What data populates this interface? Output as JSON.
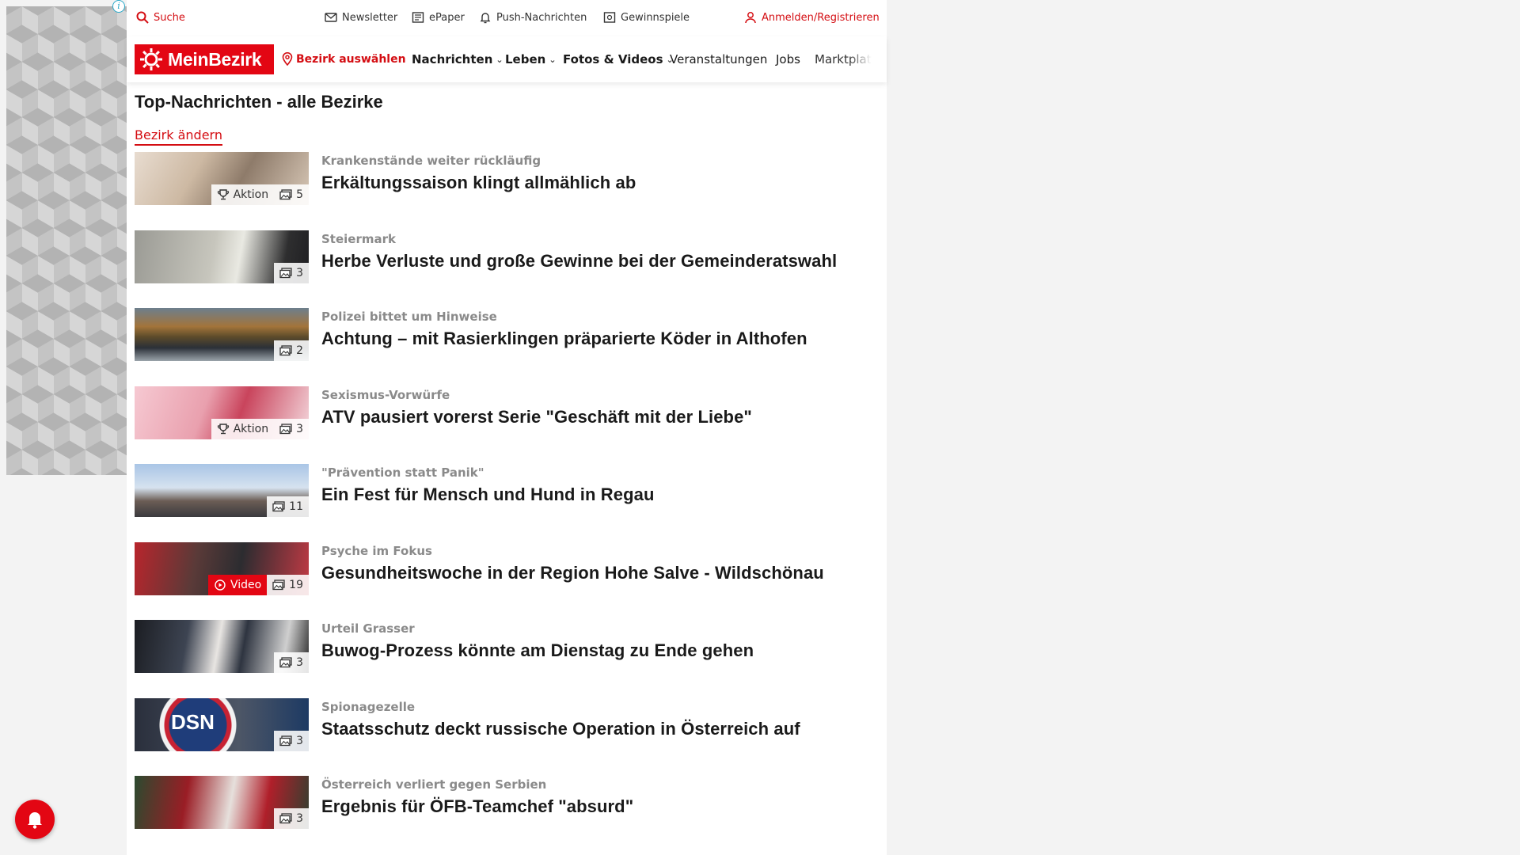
{
  "utility": {
    "search": "Suche",
    "newsletter": "Newsletter",
    "epaper": "ePaper",
    "push": "Push-Nachrichten",
    "gewinnspiele": "Gewinnspiele",
    "login": "Anmelden/Registrieren"
  },
  "brand": {
    "logo_text": "MeinBezirk",
    "accent_color": "#e30613"
  },
  "nav": {
    "bezirk": "Bezirk auswählen",
    "nachrichten": "Nachrichten",
    "leben": "Leben",
    "fotos": "Fotos & Videos",
    "veranstaltungen": "Veranstaltungen",
    "jobs": "Jobs",
    "markt": "Marktplatz"
  },
  "page": {
    "title": "Top-Nachrichten - alle Bezirke",
    "change_district": "Bezirk ändern"
  },
  "articles": [
    {
      "topline": "Krankenstände weiter rückläufig",
      "headline": "Erkältungssaison klingt allmählich ab",
      "aktion": "Aktion",
      "images": "5"
    },
    {
      "topline": "Steiermark",
      "headline": "Herbe Verluste und große Gewinne bei der Gemeinderatswahl",
      "images": "3"
    },
    {
      "topline": "Polizei bittet um Hinweise",
      "headline": "Achtung – mit Rasierklingen präparierte Köder in Althofen",
      "images": "2"
    },
    {
      "topline": "Sexismus-Vorwürfe",
      "headline": "ATV pausiert vorerst Serie \"Geschäft mit der Liebe\"",
      "aktion": "Aktion",
      "images": "3"
    },
    {
      "topline": "\"Prävention statt Panik\"",
      "headline": "Ein Fest für Mensch und Hund in Regau",
      "images": "11"
    },
    {
      "topline": "Psyche im Fokus",
      "headline": "Gesundheitswoche in der Region Hohe Salve - Wildschönau",
      "video": "Video",
      "images": "19"
    },
    {
      "topline": "Urteil Grasser",
      "headline": "Buwog-Prozess könnte am Dienstag zu Ende gehen",
      "images": "3"
    },
    {
      "topline": "Spionagezelle",
      "headline": "Staatsschutz deckt russische Operation in Österreich auf",
      "images": "3",
      "thumb_text": "DSN"
    },
    {
      "topline": "Österreich verliert gegen Serbien",
      "headline": "Ergebnis für ÖFB-Teamchef \"absurd\"",
      "images": "3"
    }
  ],
  "ad": {
    "info_glyph": "i"
  },
  "icons": [
    "search-icon",
    "mail-icon",
    "epaper-icon",
    "bell-icon",
    "gift-icon",
    "user-icon",
    "location-pin-icon",
    "trophy-icon",
    "gallery-icon",
    "play-icon",
    "chevron-down-icon"
  ]
}
